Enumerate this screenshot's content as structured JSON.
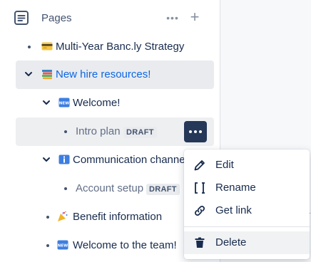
{
  "sidebar": {
    "section_title": "Pages",
    "more_icon": "more-horizontal-icon",
    "add_icon": "plus-icon",
    "items": [
      {
        "label": "Multi-Year Banc.ly Strategy",
        "emoji": "credit-card-emoji"
      },
      {
        "label": "New hire resources!",
        "emoji": "books-emoji",
        "selected": true
      },
      {
        "label": "Welcome!",
        "emoji": "new-badge-emoji"
      },
      {
        "label": "Intro plan",
        "badge": "DRAFT"
      },
      {
        "label": "Communication channe",
        "emoji": "info-emoji"
      },
      {
        "label": "Account setup",
        "badge": "DRAFT"
      },
      {
        "label": "Benefit information",
        "emoji": "party-popper-emoji"
      },
      {
        "label": "Welcome to the team!",
        "emoji": "new-badge-emoji"
      }
    ]
  },
  "context_menu": {
    "items": [
      {
        "label": "Edit",
        "icon": "pencil-icon"
      },
      {
        "label": "Rename",
        "icon": "rename-cursor-icon"
      },
      {
        "label": "Get link",
        "icon": "link-icon"
      },
      {
        "label": "Delete",
        "icon": "trash-icon"
      }
    ]
  },
  "colors": {
    "selected_text": "#0c66e4",
    "action_button": "#253858",
    "row_selected_bg": "#e9ebee"
  }
}
